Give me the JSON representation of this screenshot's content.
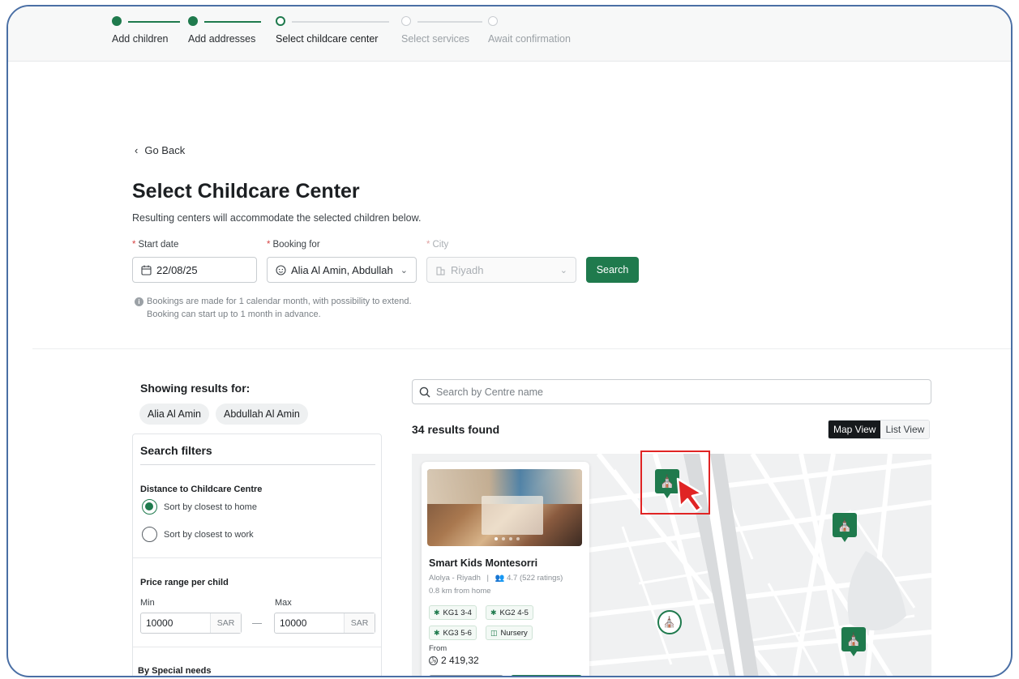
{
  "stepper": {
    "steps": [
      {
        "label": "Add children",
        "state": "done"
      },
      {
        "label": "Add addresses",
        "state": "done"
      },
      {
        "label": "Select childcare center",
        "state": "current"
      },
      {
        "label": "Select services",
        "state": "todo"
      },
      {
        "label": "Await confirmation",
        "state": "todo"
      }
    ]
  },
  "nav": {
    "go_back": "Go Back"
  },
  "page": {
    "title": "Select Childcare Center",
    "subtitle": "Resulting centers will accommodate the selected children below."
  },
  "form": {
    "start_date": {
      "label": "Start date",
      "value": "22/08/25"
    },
    "booking_for": {
      "label": "Booking for",
      "value": "Alia Al Amin, Abdullah"
    },
    "city": {
      "label": "City",
      "value": "Riyadh"
    },
    "search_label": "Search",
    "info_line1": "Bookings are made for 1 calendar month, with possibility to extend.",
    "info_line2": "Booking can start up to 1 month in advance."
  },
  "sidebar": {
    "showing_title": "Showing results for:",
    "children": [
      "Alia Al Amin",
      "Abdullah Al Amin"
    ],
    "filters_title": "Search filters",
    "distance_title": "Distance to Childcare Centre",
    "sort_home": "Sort by closest to home",
    "sort_work": "Sort by closest to work",
    "price_title": "Price range per child",
    "min_label": "Min",
    "max_label": "Max",
    "min_value": "10000",
    "max_value": "10000",
    "currency": "SAR",
    "special_needs_title": "By Special needs"
  },
  "results": {
    "search_placeholder": "Search by Centre name",
    "count_text": "34 results found",
    "map_view": "Map View",
    "list_view": "List View"
  },
  "card": {
    "name": "Smart Kids Montesorri",
    "location": "Alolya - Riyadh",
    "rating": "4.7 (522 ratings)",
    "distance": "0.8 km from home",
    "tags": [
      "KG1 3-4",
      "KG2 4-5",
      "KG3 5-6",
      "Nursery"
    ],
    "from_label": "From",
    "price": "2 419,32"
  },
  "colors": {
    "brand": "#1f7a4d",
    "highlight": "#e02424",
    "frame": "#4a6fa5"
  }
}
